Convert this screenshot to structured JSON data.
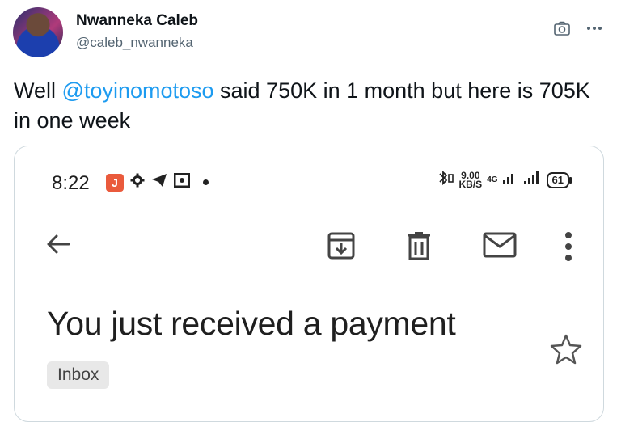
{
  "tweet": {
    "author_name": "Nwanneka Caleb",
    "author_handle": "@caleb_nwanneka",
    "text_prefix": "Well ",
    "mention": "@toyinomotoso",
    "text_suffix": " said 750K in 1 month but here is 705K in one week"
  },
  "icons": {
    "top_right": [
      "camera-icon",
      "more-icon"
    ]
  },
  "phone": {
    "status_bar": {
      "time": "8:22",
      "app_badge": "J",
      "speed_value": "9.00",
      "speed_unit": "KB/S",
      "network": "4G",
      "battery": "61"
    },
    "email": {
      "subject": "You just received a payment",
      "label": "Inbox"
    }
  },
  "colors": {
    "mention": "#1d9bf0",
    "secondary_text": "#536471",
    "notif_badge": "#ea5a3c"
  }
}
